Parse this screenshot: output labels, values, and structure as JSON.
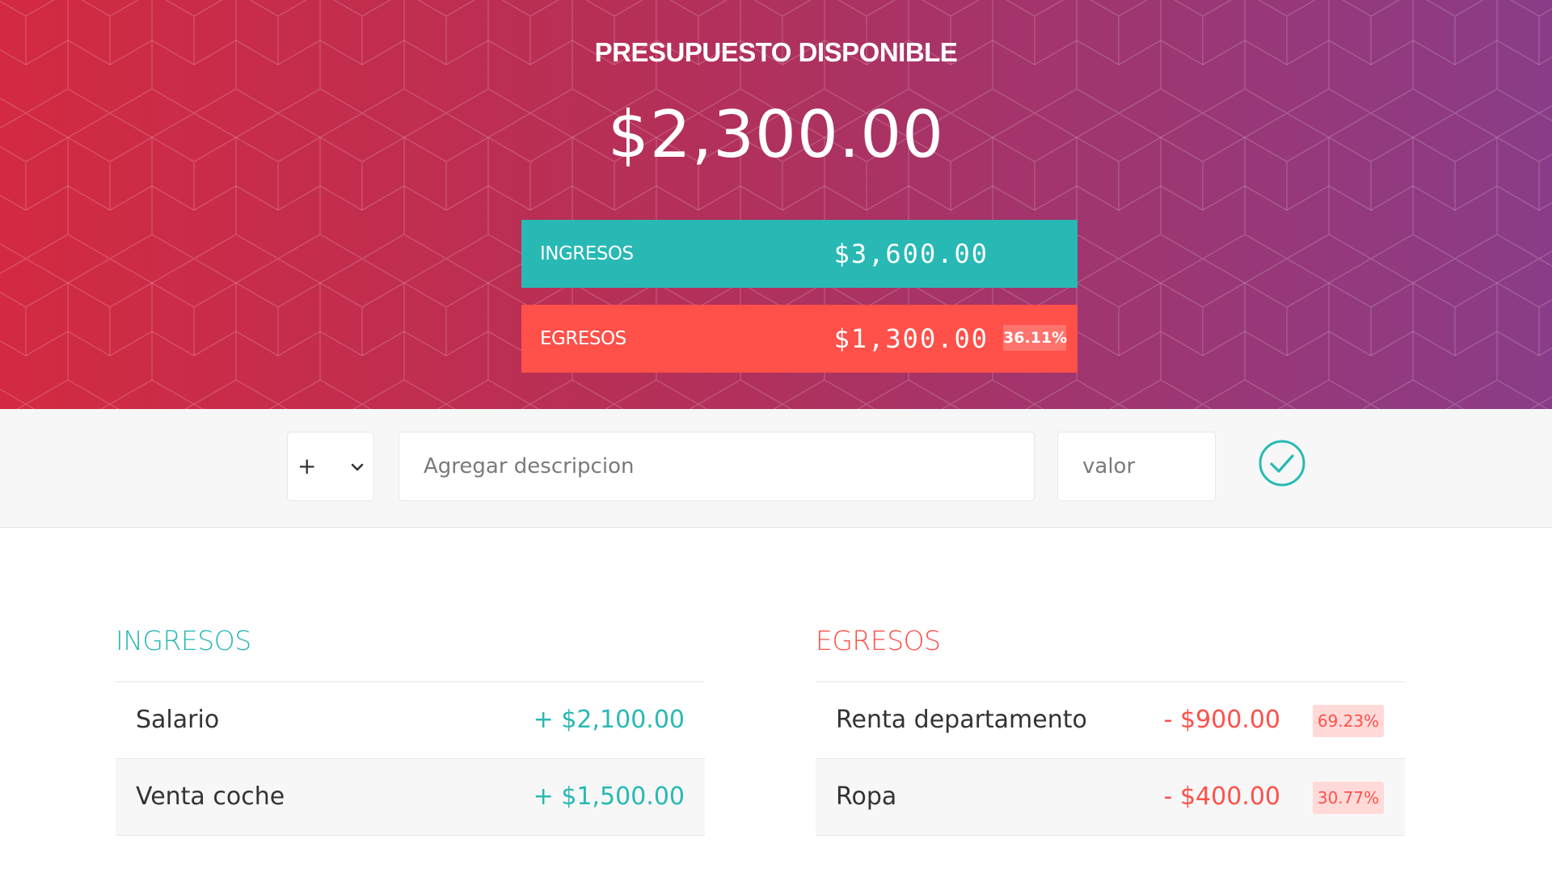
{
  "header": {
    "title": "PRESUPUESTO DISPONIBLE",
    "budget": "$2,300.00",
    "income": {
      "label": "INGRESOS",
      "value": "$3,600.00"
    },
    "expense": {
      "label": "EGRESOS",
      "value": "$1,300.00",
      "percentage": "36.11%"
    },
    "colors": {
      "gradient_start": "#d32a41",
      "gradient_end": "#8a3c88"
    }
  },
  "add_form": {
    "type_value": "+",
    "description_placeholder": "Agregar descripcion",
    "value_placeholder": "valor",
    "submit_icon": "check-circle-icon"
  },
  "income_list": {
    "title": "INGRESOS",
    "color": "#28b9b5",
    "items": [
      {
        "description": "Salario",
        "value": "+ $2,100.00"
      },
      {
        "description": "Venta coche",
        "value": "+ $1,500.00"
      }
    ]
  },
  "expense_list": {
    "title": "EGRESOS",
    "color": "#ff5049",
    "items": [
      {
        "description": "Renta departamento",
        "value": "- $900.00",
        "percentage": "69.23%"
      },
      {
        "description": "Ropa",
        "value": "- $400.00",
        "percentage": "30.77%"
      }
    ]
  }
}
